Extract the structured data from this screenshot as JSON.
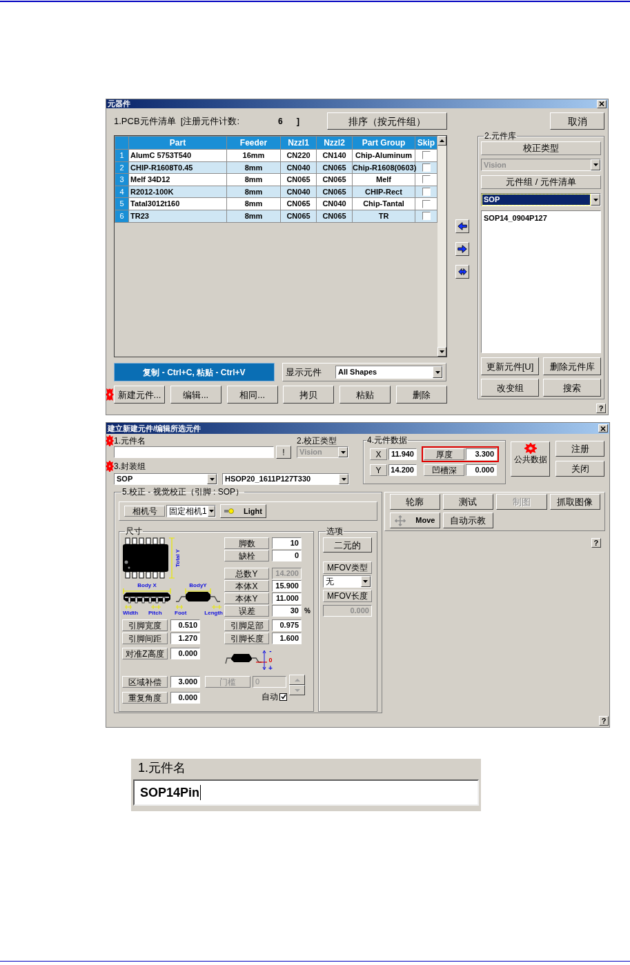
{
  "parts_dialog": {
    "title": "元器件",
    "count_label": "1.PCB元件清单  [注册元件计数:",
    "count": "6",
    "count_end": "]",
    "sort_button": "排序（按元件组）",
    "cancel_button": "取消",
    "table": {
      "columns": [
        "Part",
        "Feeder",
        "Nzzl1",
        "Nzzl2",
        "Part Group",
        "Skip"
      ],
      "rows": [
        {
          "index": "1",
          "part": "AlumC 5753T540",
          "feeder": "16mm",
          "nzzl1": "CN220",
          "nzzl2": "CN140",
          "group": "Chip-Aluminum",
          "skip": false
        },
        {
          "index": "2",
          "part": "CHIP-R1608T0.45",
          "feeder": "8mm",
          "nzzl1": "CN040",
          "nzzl2": "CN065",
          "group": "Chip-R1608(0603)",
          "skip": false
        },
        {
          "index": "3",
          "part": "Melf 34D12",
          "feeder": "8mm",
          "nzzl1": "CN065",
          "nzzl2": "CN065",
          "group": "Melf",
          "skip": false
        },
        {
          "index": "4",
          "part": "R2012-100K",
          "feeder": "8mm",
          "nzzl1": "CN040",
          "nzzl2": "CN065",
          "group": "CHIP-Rect",
          "skip": false
        },
        {
          "index": "5",
          "part": "Tatal3012t160",
          "feeder": "8mm",
          "nzzl1": "CN065",
          "nzzl2": "CN040",
          "group": "Chip-Tantal",
          "skip": false
        },
        {
          "index": "6",
          "part": "TR23",
          "feeder": "8mm",
          "nzzl1": "CN065",
          "nzzl2": "CN065",
          "group": "TR",
          "skip": false
        }
      ]
    },
    "hint": "复制 - Ctrl+C, 粘贴 - Ctrl+V",
    "filter": {
      "label": "显示元件",
      "value": "All Shapes"
    },
    "buttons": [
      {
        "label": "新建元件...",
        "marked": true
      },
      {
        "label": "编辑...",
        "marked": false
      },
      {
        "label": "相同...",
        "marked": false
      },
      {
        "label": "拷贝",
        "marked": false
      },
      {
        "label": "粘贴",
        "marked": false
      },
      {
        "label": "删除",
        "marked": false
      }
    ],
    "library": {
      "title": "2.元件库",
      "type_label": "校正类型",
      "type": {
        "value": "Vision",
        "disabled": true
      },
      "list_label": "元件组 / 元件清单",
      "group": {
        "value": "SOP",
        "focused": true
      },
      "items": [
        {
          "label": "SOP14_0904P127",
          "selected": false
        }
      ],
      "buttons": [
        "更新元件[U]",
        "删除元件库",
        "改变组",
        "搜索"
      ]
    },
    "help": "?"
  },
  "edit_dialog": {
    "title": "建立新建元件/编辑所选元件",
    "name": {
      "label": "1.元件名",
      "marked": true
    },
    "check_button": "!",
    "calibration": {
      "label": "2.校正类型",
      "value": "Vision",
      "disabled": true
    },
    "package": {
      "label": "3.封装组",
      "marked": true,
      "group": "SOP",
      "name": "HSOP20_1611P127T330"
    },
    "part_data": {
      "title": "4.元件数据",
      "fields": [
        {
          "label": "X",
          "value": "11.940",
          "highlighted": false
        },
        {
          "label": "厚度",
          "value": "3.300",
          "highlighted": true
        },
        {
          "label": "Y",
          "value": "14.200",
          "highlighted": false
        },
        {
          "label": "凹槽深",
          "value": "0.000",
          "highlighted": false
        }
      ]
    },
    "common_button": {
      "label": "公共数据",
      "marked": true
    },
    "side_buttons": [
      "注册",
      "关闭"
    ],
    "vision": {
      "title": "5.校正 - 视觉校正（引脚 : SOP）",
      "camera_label": "相机号",
      "camera": "固定相机1",
      "light_button": "Light",
      "size": {
        "title": "尺寸",
        "diagram": {
          "total_y": "Total Y",
          "body_x": "Body X",
          "body_y": "BodyY",
          "width": "Width",
          "pitch": "Pitch",
          "foot": "Foot",
          "length": "Length"
        },
        "fields": [
          {
            "label": "脚数",
            "value": "10",
            "disabled": false
          },
          {
            "label": "缺栓",
            "value": "0",
            "disabled": false
          },
          {
            "label": "总数Y",
            "value": "14.200",
            "disabled": true
          },
          {
            "label": "本体X",
            "value": "15.900",
            "disabled": false
          },
          {
            "label": "本体Y",
            "value": "11.000",
            "disabled": false
          },
          {
            "label": "误差",
            "value": "30",
            "disabled": false,
            "unit": "%"
          }
        ],
        "lead_left": [
          {
            "label": "引脚宽度",
            "value": "0.510"
          },
          {
            "label": "引脚间距",
            "value": "1.270"
          }
        ],
        "lead_right": [
          {
            "label": "引脚足部",
            "value": "0.975"
          },
          {
            "label": "引脚长度",
            "value": "1.600"
          }
        ],
        "z_height": {
          "label": "对准Z高度",
          "value": "0.000"
        },
        "offset_marks": {
          "minus": "-",
          "zero": "0",
          "plus": "+"
        },
        "region": {
          "label": "区域补偿",
          "value": "3.000"
        },
        "threshold": {
          "label": "门槛",
          "value": "0",
          "disabled": true
        },
        "auto": {
          "label": "自动",
          "checked": true
        },
        "angle": {
          "label": "重复角度",
          "value": "0.000"
        }
      },
      "options": {
        "title": "选项",
        "binary_button": "二元的",
        "mfov_type_label": "MFOV类型",
        "mfov_type": "无",
        "mfov_length_label": "MFOV长度",
        "mfov_length": {
          "value": "0.000",
          "disabled": true
        }
      }
    },
    "tools": [
      {
        "label": "轮廓",
        "kind": "plain",
        "disabled": false
      },
      {
        "label": "测试",
        "kind": "plain",
        "disabled": false
      },
      {
        "label": "制图",
        "kind": "plain",
        "disabled": true
      },
      {
        "label": "抓取图像",
        "kind": "plain",
        "disabled": false
      },
      {
        "label": "Move",
        "kind": "move",
        "disabled": false
      },
      {
        "label": "自动示教",
        "kind": "plain",
        "disabled": false
      }
    ],
    "help": [
      "?",
      "?"
    ]
  },
  "inset": {
    "label": "1.元件名",
    "value": "SOP14Pin"
  }
}
